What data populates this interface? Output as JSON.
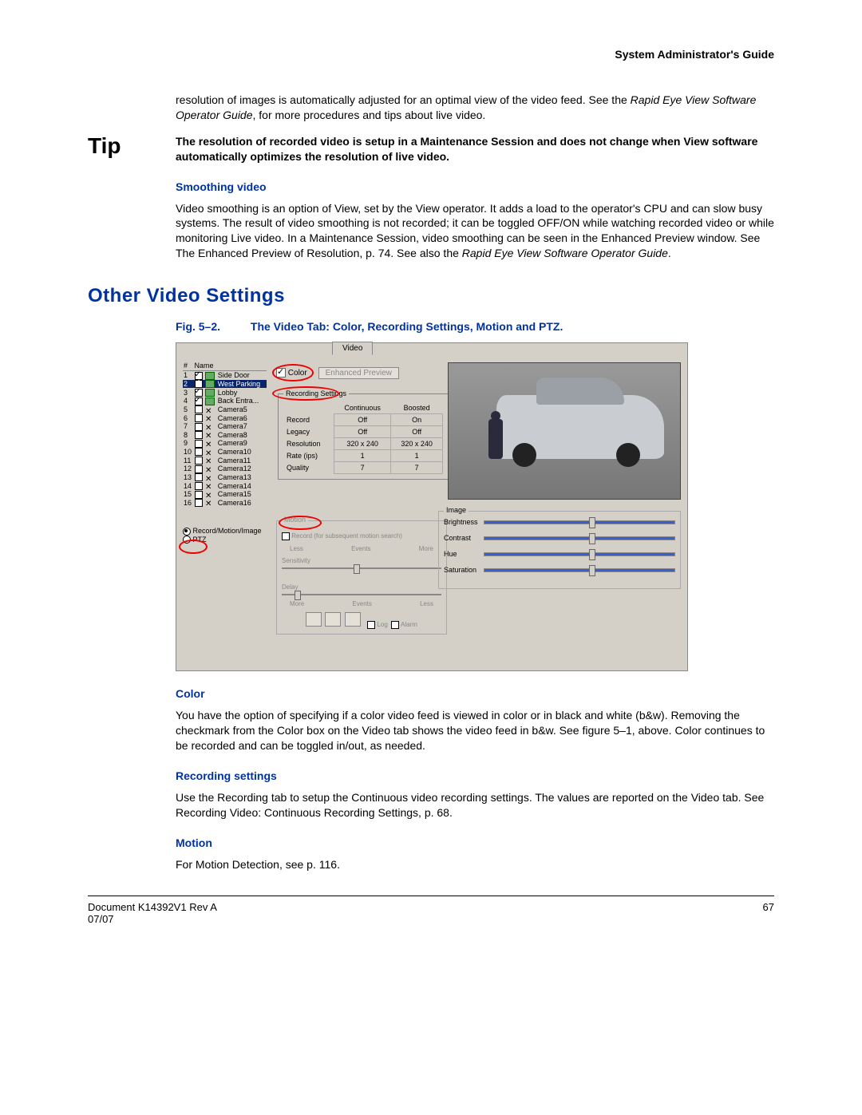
{
  "header": {
    "guide_title": "System Administrator's Guide"
  },
  "intro": {
    "para1_a": "resolution of images is automatically adjusted for an optimal view of the video feed. See the ",
    "para1_b": "Rapid Eye View Software Operator Guide",
    "para1_c": ", for more procedures and tips about live video."
  },
  "tip": {
    "label": "Tip",
    "text": "The resolution of recorded video is setup in a Maintenance Session and does not change when View software automatically optimizes the resolution of live video."
  },
  "smoothing": {
    "heading": "Smoothing video",
    "para_a": "Video smoothing is an option of View, set by the View operator. It adds a load to the operator's CPU and can slow busy systems. The result of video smoothing is not recorded; it can be toggled OFF/ON while watching recorded video or while monitoring Live video. In a Maintenance Session, video smoothing can be seen in the Enhanced Preview window. See The Enhanced Preview of Resolution, p. 74. See also the ",
    "para_b": "Rapid Eye View Software Operator Guide",
    "para_c": "."
  },
  "section": {
    "heading": "Other Video Settings"
  },
  "figure": {
    "label": "Fig. 5–2.",
    "caption": "The Video Tab: Color, Recording Settings, Motion and PTZ.",
    "tab_label": "Video",
    "cam_list": {
      "col_num": "#",
      "col_name": "Name",
      "rows": [
        {
          "n": "1",
          "checked": true,
          "on": true,
          "name": "Side Door"
        },
        {
          "n": "2",
          "checked": true,
          "on": true,
          "name": "West Parking",
          "selected": true
        },
        {
          "n": "3",
          "checked": true,
          "on": true,
          "name": "Lobby"
        },
        {
          "n": "4",
          "checked": true,
          "on": true,
          "name": "Back Entra..."
        },
        {
          "n": "5",
          "checked": false,
          "on": false,
          "name": "Camera5"
        },
        {
          "n": "6",
          "checked": false,
          "on": false,
          "name": "Camera6"
        },
        {
          "n": "7",
          "checked": false,
          "on": false,
          "name": "Camera7"
        },
        {
          "n": "8",
          "checked": false,
          "on": false,
          "name": "Camera8"
        },
        {
          "n": "9",
          "checked": false,
          "on": false,
          "name": "Camera9"
        },
        {
          "n": "10",
          "checked": false,
          "on": false,
          "name": "Camera10"
        },
        {
          "n": "11",
          "checked": false,
          "on": false,
          "name": "Camera11"
        },
        {
          "n": "12",
          "checked": false,
          "on": false,
          "name": "Camera12"
        },
        {
          "n": "13",
          "checked": false,
          "on": false,
          "name": "Camera13"
        },
        {
          "n": "14",
          "checked": false,
          "on": false,
          "name": "Camera14"
        },
        {
          "n": "15",
          "checked": false,
          "on": false,
          "name": "Camera15"
        },
        {
          "n": "16",
          "checked": false,
          "on": false,
          "name": "Camera16"
        }
      ]
    },
    "radios": {
      "opt1": "Record/Motion/Image",
      "opt2": "PTZ"
    },
    "color_label": "Color",
    "enhanced_preview_btn": "Enhanced Preview",
    "rec_settings": {
      "legend": "Recording Settings",
      "col_cont": "Continuous",
      "col_boost": "Boosted",
      "rows": {
        "record": {
          "label": "Record",
          "c": "Off",
          "b": "On"
        },
        "legacy": {
          "label": "Legacy",
          "c": "Off",
          "b": "Off"
        },
        "resolution": {
          "label": "Resolution",
          "c": "320 x 240",
          "b": "320 x 240"
        },
        "rate": {
          "label": "Rate (ips)",
          "c": "1",
          "b": "1"
        },
        "quality": {
          "label": "Quality",
          "c": "7",
          "b": "7"
        }
      }
    },
    "motion": {
      "legend": "Motion",
      "record_label": "Record (for subsequent motion search)",
      "less": "Less",
      "events": "Events",
      "more": "More",
      "sensitivity": "Sensitivity",
      "delay": "Delay",
      "more2": "More",
      "events2": "Events",
      "less2": "Less",
      "log_chk": "Log",
      "alarm_chk": "Alarm"
    },
    "image": {
      "legend": "Image",
      "brightness": "Brightness",
      "contrast": "Contrast",
      "hue": "Hue",
      "saturation": "Saturation"
    }
  },
  "color_section": {
    "heading": "Color",
    "para": "You have the option of specifying if a color video feed is viewed in color or in black and white (b&w). Removing the checkmark from the Color box on the Video tab shows the video feed in b&w. See figure 5–1, above. Color continues to be recorded and can be toggled in/out, as needed."
  },
  "recording_section": {
    "heading": "Recording settings",
    "para": "Use the Recording tab to setup the Continuous video recording settings. The values are reported on the Video tab. See Recording Video: Continuous Recording Settings, p. 68."
  },
  "motion_section": {
    "heading": "Motion",
    "para": "For Motion Detection, see p. 116."
  },
  "footer": {
    "left_line1": "Document K14392V1 Rev A",
    "left_line2": "07/07",
    "page": "67"
  }
}
